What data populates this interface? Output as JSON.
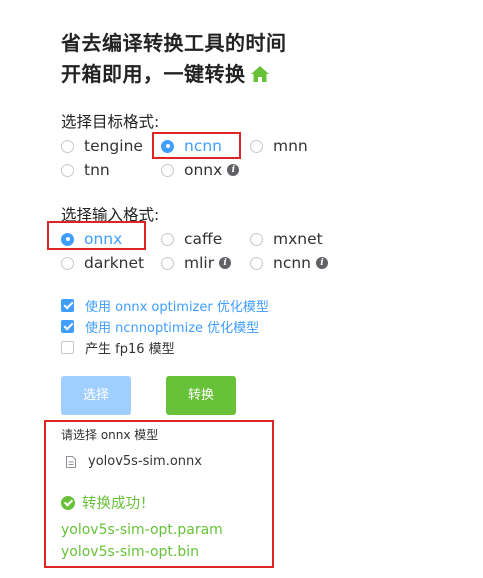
{
  "hero": {
    "line1": "省去编译转换工具的时间",
    "line2": "开箱即用，一键转换",
    "icon": "home-icon"
  },
  "target": {
    "label": "选择目标格式:",
    "options": [
      {
        "label": "tengine",
        "selected": false,
        "info": false
      },
      {
        "label": "ncnn",
        "selected": true,
        "info": false
      },
      {
        "label": "mnn",
        "selected": false,
        "info": false
      },
      {
        "label": "tnn",
        "selected": false,
        "info": false
      },
      {
        "label": "onnx",
        "selected": false,
        "info": true
      }
    ]
  },
  "input": {
    "label": "选择输入格式:",
    "options": [
      {
        "label": "onnx",
        "selected": true,
        "info": false
      },
      {
        "label": "caffe",
        "selected": false,
        "info": false
      },
      {
        "label": "mxnet",
        "selected": false,
        "info": false
      },
      {
        "label": "darknet",
        "selected": false,
        "info": false
      },
      {
        "label": "mlir",
        "selected": false,
        "info": true
      },
      {
        "label": "ncnn",
        "selected": false,
        "info": true
      }
    ]
  },
  "checks": [
    {
      "label": "使用 onnx optimizer 优化模型",
      "checked": true
    },
    {
      "label": "使用 ncnnoptimize 优化模型",
      "checked": true
    },
    {
      "label": "产生 fp16 模型",
      "checked": false
    }
  ],
  "buttons": {
    "select": "选择",
    "convert": "转换"
  },
  "result": {
    "title": "请选择 onnx 模型",
    "file_name": "yolov5s-sim.onnx",
    "success": "转换成功！",
    "outputs": [
      "yolov5s-sim-opt.param",
      "yolov5s-sim-opt.bin"
    ]
  },
  "colors": {
    "accent": "#409eff",
    "success": "#67c23a",
    "highlight_box": "#e02424",
    "disabled_button": "#a0cfff"
  },
  "icons": {
    "info": "i",
    "file": "document-icon",
    "success": "check-circle-icon"
  }
}
